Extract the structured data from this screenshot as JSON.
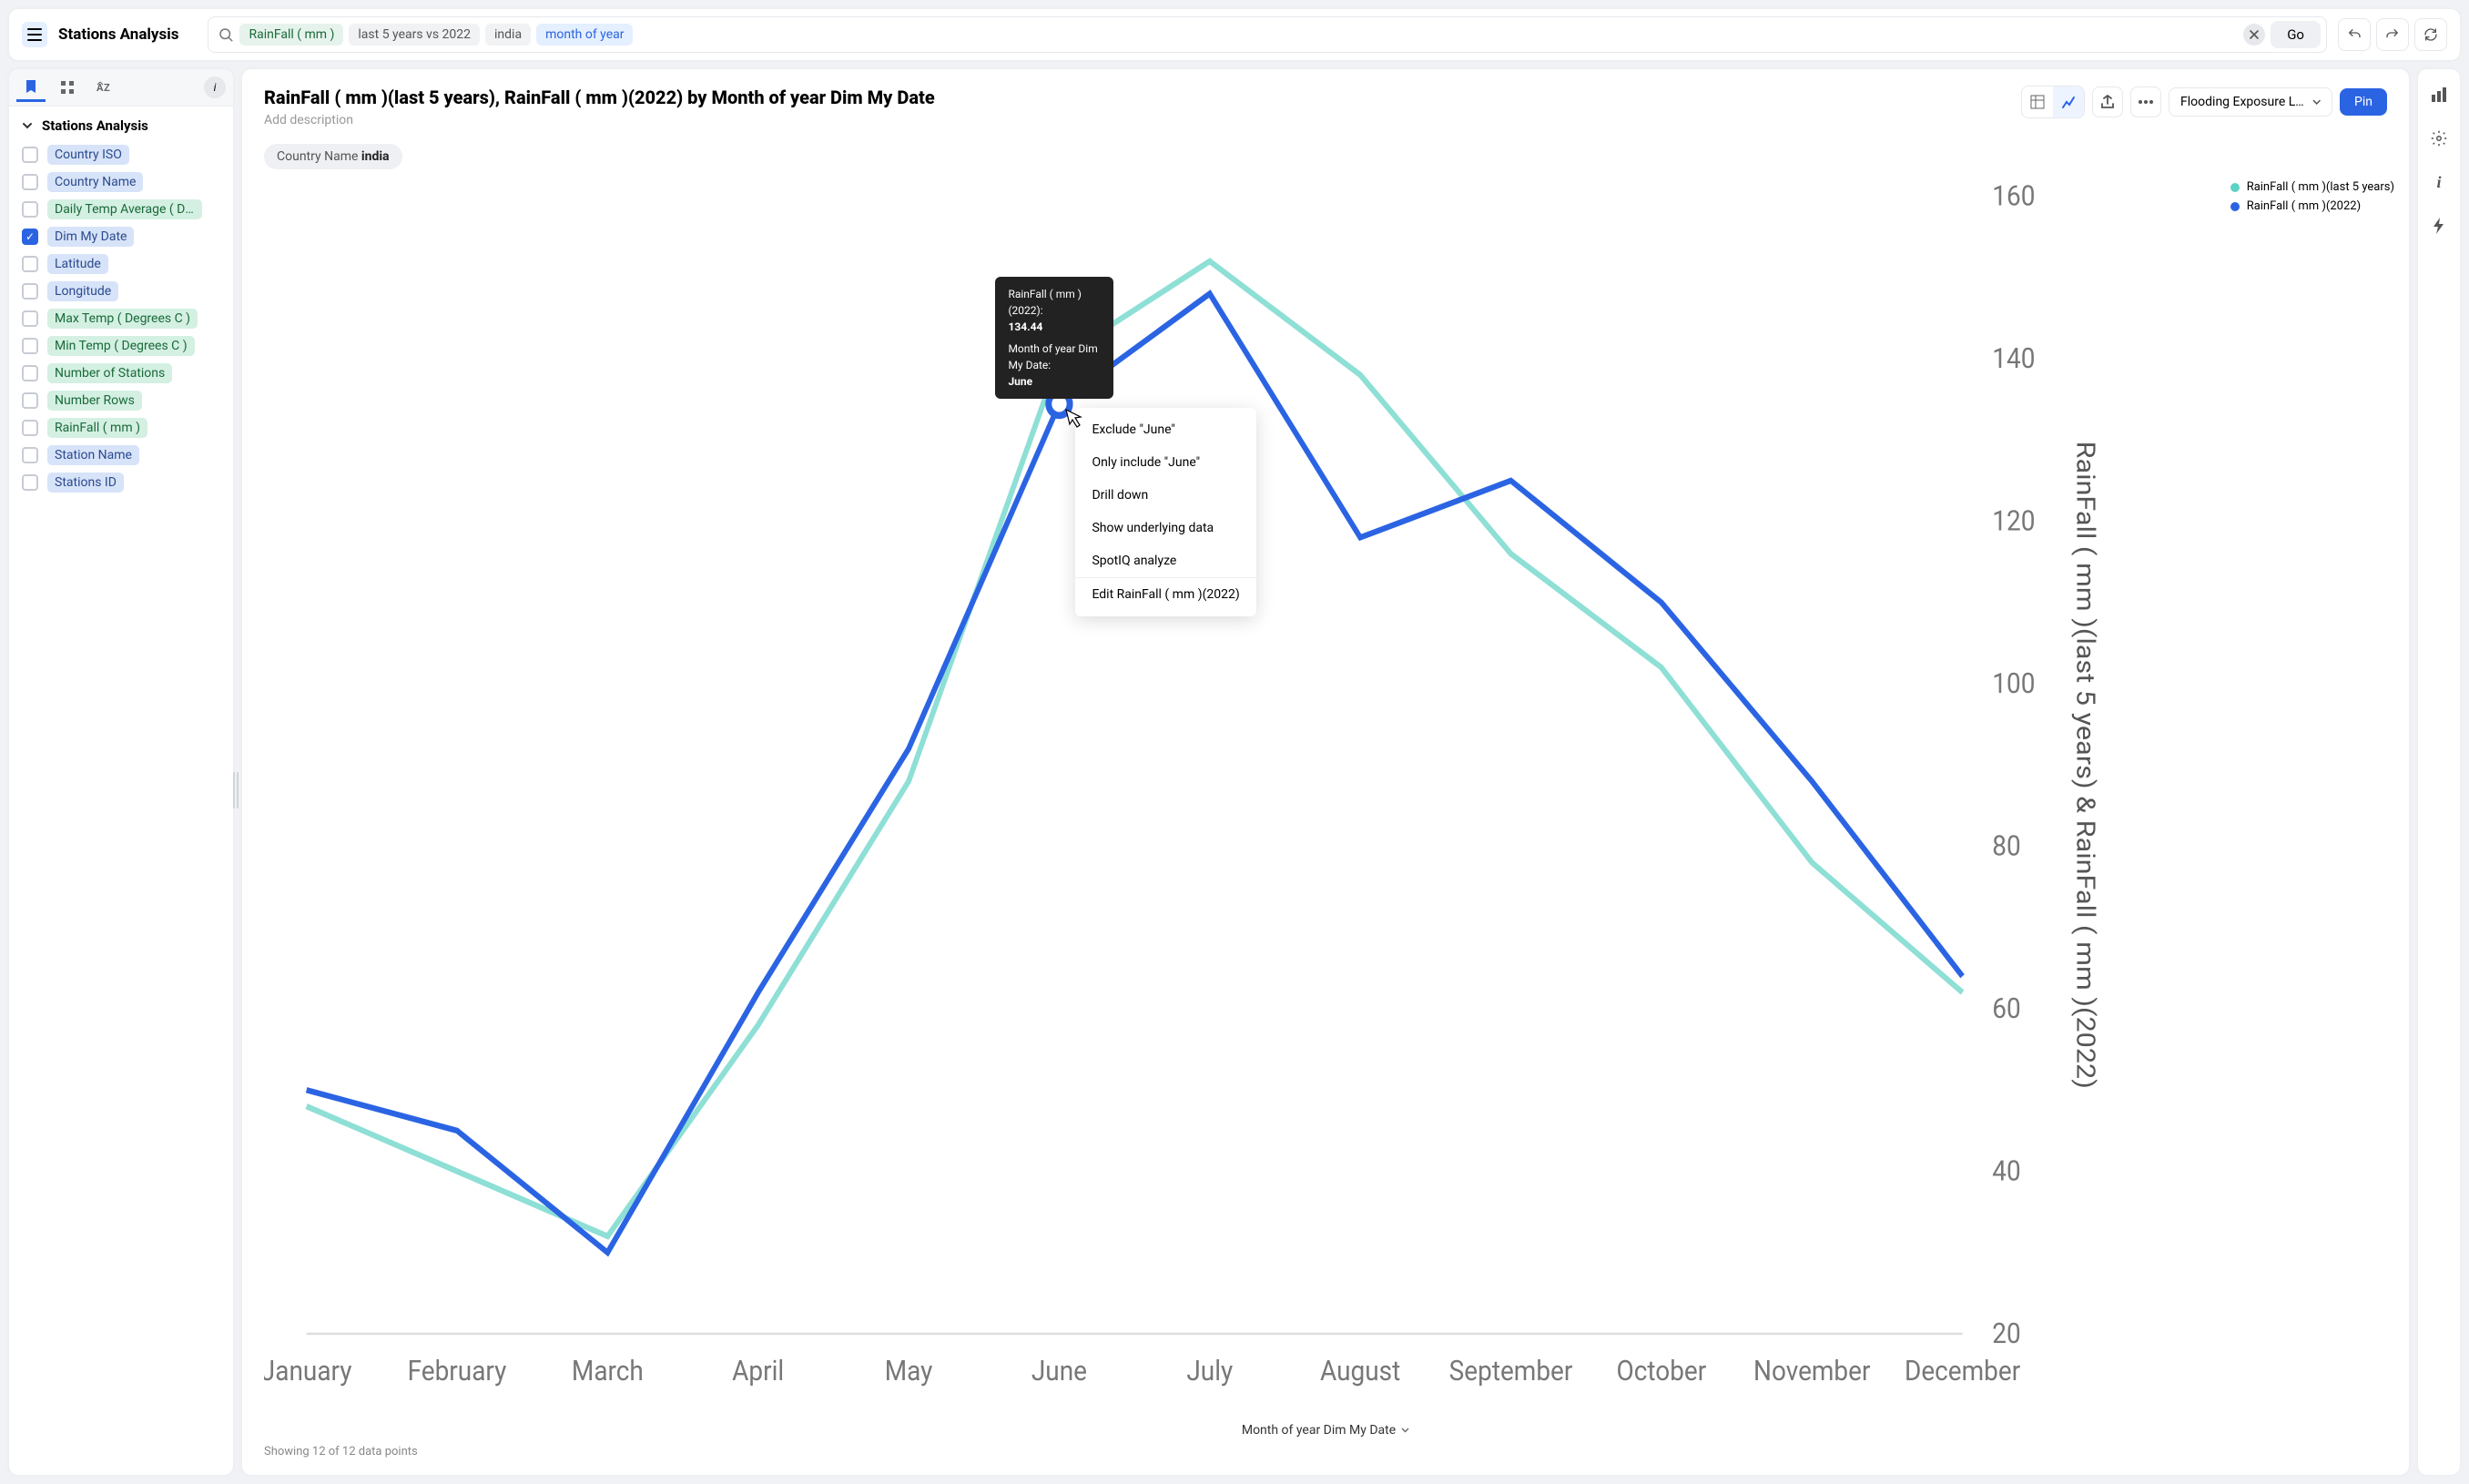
{
  "header": {
    "app_title": "Stations Analysis",
    "go_label": "Go"
  },
  "search_tokens": [
    {
      "text": "RainFall ( mm )",
      "kind": "measure"
    },
    {
      "text": "last 5 years vs 2022",
      "kind": "filter"
    },
    {
      "text": "india",
      "kind": "filter"
    },
    {
      "text": "month of year",
      "kind": "dim"
    }
  ],
  "left_panel": {
    "header": "Stations Analysis",
    "fields": [
      {
        "label": "Country ISO",
        "type": "attr",
        "checked": false
      },
      {
        "label": "Country Name",
        "type": "attr",
        "checked": false
      },
      {
        "label": "Daily Temp Average ( Degr...",
        "type": "meas",
        "checked": false
      },
      {
        "label": "Dim My Date",
        "type": "attr",
        "checked": true
      },
      {
        "label": "Latitude",
        "type": "attr",
        "checked": false
      },
      {
        "label": "Longitude",
        "type": "attr",
        "checked": false
      },
      {
        "label": "Max Temp ( Degrees C )",
        "type": "meas",
        "checked": false
      },
      {
        "label": "Min Temp ( Degrees C )",
        "type": "meas",
        "checked": false
      },
      {
        "label": "Number of Stations",
        "type": "meas",
        "checked": false
      },
      {
        "label": "Number Rows",
        "type": "meas",
        "checked": false
      },
      {
        "label": "RainFall ( mm )",
        "type": "meas",
        "checked": false
      },
      {
        "label": "Station Name",
        "type": "attr",
        "checked": false
      },
      {
        "label": "Stations ID",
        "type": "attr",
        "checked": false
      }
    ]
  },
  "chart_header": {
    "title": "RainFall ( mm )(last 5 years), RainFall ( mm )(2022) by Month of year Dim My Date",
    "description_placeholder": "Add description",
    "board_selector": "Flooding Exposure Liv...",
    "pin_label": "Pin"
  },
  "filter_chip": {
    "label": "Country Name",
    "value": "india"
  },
  "chart_data": {
    "type": "line",
    "xlabel": "Month of year Dim My Date",
    "ylabel": "RainFall ( mm )(last 5 years) & RainFall ( mm )(2022)",
    "ylim": [
      20,
      160
    ],
    "y_ticks": [
      20,
      40,
      60,
      80,
      100,
      120,
      140,
      160
    ],
    "categories": [
      "January",
      "February",
      "March",
      "April",
      "May",
      "June",
      "July",
      "August",
      "September",
      "October",
      "November",
      "December"
    ],
    "series": [
      {
        "name": "RainFall ( mm )(last 5 years)",
        "color": "#5ed2c3",
        "values": [
          48,
          40,
          32,
          58,
          88,
          140,
          152,
          138,
          116,
          102,
          78,
          62
        ]
      },
      {
        "name": "RainFall ( mm )(2022)",
        "color": "#2b64e3",
        "values": [
          50,
          45,
          30,
          62,
          92,
          134.44,
          148,
          118,
          125,
          110,
          88,
          64
        ]
      }
    ]
  },
  "tooltip": {
    "line1_label": "RainFall ( mm ) (2022):",
    "line1_value": "134.44",
    "line2_label": "Month of year Dim My Date:",
    "line2_value": "June"
  },
  "context_menu": [
    "Exclude \"June\"",
    "Only include \"June\"",
    "Drill down",
    "Show underlying data",
    "SpotIQ analyze",
    "Edit RainFall ( mm )(2022)"
  ],
  "data_count": "Showing 12 of 12 data points",
  "colors": {
    "primary": "#2b64e3",
    "teal": "#5ed2c3"
  }
}
